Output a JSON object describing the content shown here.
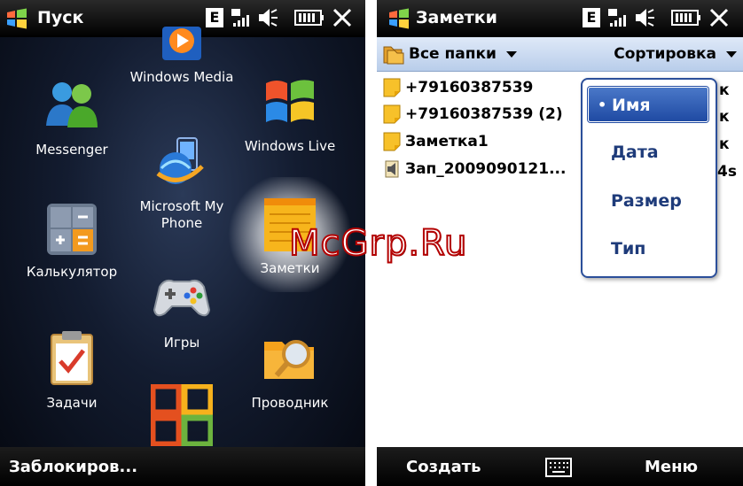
{
  "left": {
    "title": "Пуск",
    "tiles": {
      "windows_media": "Windows Media",
      "messenger": "Messenger",
      "windows_live": "Windows Live",
      "microsoft_my_phone": "Microsoft My Phone",
      "calculator": "Калькулятор",
      "notes": "Заметки",
      "games": "Игры",
      "tasks": "Задачи",
      "explorer": "Проводник"
    },
    "bottom_left": "Заблокиров..."
  },
  "right": {
    "title": "Заметки",
    "folder_menu": "Все папки",
    "sort_menu": "Сортировка",
    "notes": [
      {
        "name": "+79160387539",
        "suffix": "к"
      },
      {
        "name": "+79160387539 (2)",
        "suffix": "к"
      },
      {
        "name": "Заметка1",
        "suffix": "к"
      },
      {
        "name": "Зап_2009090121...",
        "suffix": "4s"
      }
    ],
    "sort_options": [
      "Имя",
      "Дата",
      "Размер",
      "Тип"
    ],
    "selected_sort": "Имя",
    "bottom_left": "Создать",
    "bottom_right": "Меню"
  },
  "status_indicator": "E",
  "watermark": "McGrp.Ru",
  "icons": [
    "windows-flag-icon",
    "edge-network-icon",
    "signal-icon",
    "speaker-muted-icon",
    "battery-icon",
    "close-icon",
    "keyboard-icon"
  ]
}
